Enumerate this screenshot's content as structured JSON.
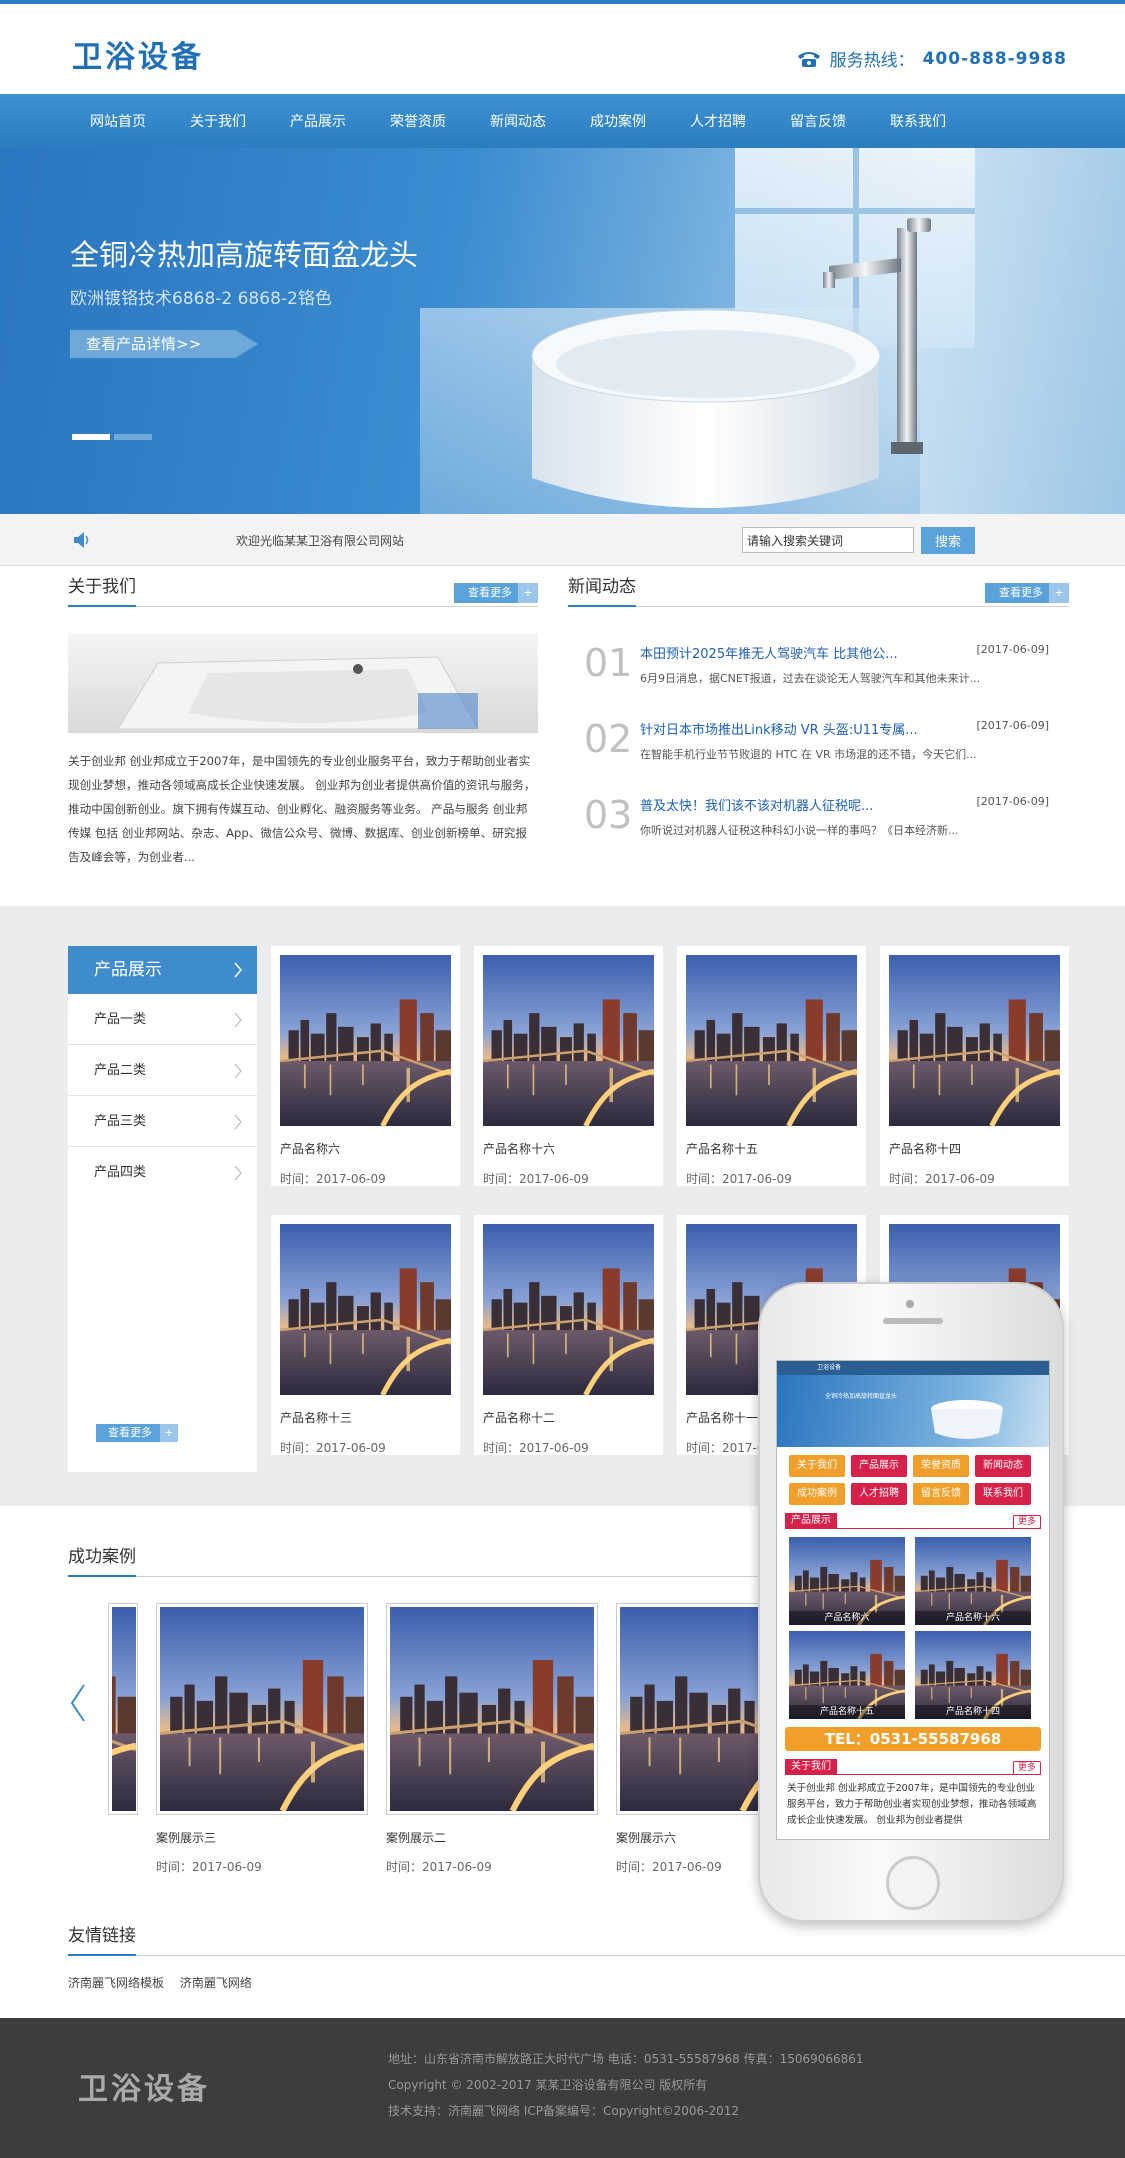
{
  "header": {
    "logo": "卫浴设备",
    "hotline_label": "服务热线：",
    "hotline_number": "400-888-9988"
  },
  "nav": [
    "网站首页",
    "关于我们",
    "产品展示",
    "荣誉资质",
    "新闻动态",
    "成功案例",
    "人才招聘",
    "留言反馈",
    "联系我们"
  ],
  "banner": {
    "title": "全铜冷热加高旋转面盆龙头",
    "subtitle": "欧洲镀铬技术6868-2 6868-2铬色",
    "button": "查看产品详情>>",
    "slides": 2,
    "active_slide": 1
  },
  "notice": {
    "welcome": "欢迎光临某某卫浴有限公司网站",
    "search_value": "请输入搜索关键词",
    "search_button": "搜索"
  },
  "about": {
    "title": "关于我们",
    "more": "查看更多",
    "text": "关于创业邦 创业邦成立于2007年，是中国领先的专业创业服务平台，致力于帮助创业者实现创业梦想，推动各领域高成长企业快速发展。 创业邦为创业者提供高价值的资讯与服务，推动中国创新创业。旗下拥有传媒互动、创业孵化、融资服务等业务。 产品与服务 创业邦传媒 包括 创业邦网站、杂志、App、微信公众号、微博、数据库、创业创新榜单、研究报告及峰会等，为创业者..."
  },
  "news": {
    "title": "新闻动态",
    "more": "查看更多",
    "items": [
      {
        "num": "01",
        "title": "本田预计2025年推无人驾驶汽车 比其他公...",
        "date": "[2017-06-09]",
        "summary": "6月9日消息，据CNET报道，过去在谈论无人驾驶汽车和其他未来计..."
      },
      {
        "num": "02",
        "title": "针对日本市场推出Link移动 VR 头盔:U11专属...",
        "date": "[2017-06-09]",
        "summary": "在智能手机行业节节败退的 HTC 在 VR 市场混的还不错，今天它们..."
      },
      {
        "num": "03",
        "title": "普及太快！我们该不该对机器人征税呢...",
        "date": "[2017-06-09]",
        "summary": "你听说过对机器人征税这种科幻小说一样的事吗？《日本经济新..."
      }
    ]
  },
  "products": {
    "side_title": "产品展示",
    "categories": [
      "产品一类",
      "产品二类",
      "产品三类",
      "产品四类"
    ],
    "more": "查看更多",
    "items": [
      {
        "name": "产品名称六",
        "date": "时间：2017-06-09"
      },
      {
        "name": "产品名称十六",
        "date": "时间：2017-06-09"
      },
      {
        "name": "产品名称十五",
        "date": "时间：2017-06-09"
      },
      {
        "name": "产品名称十四",
        "date": "时间：2017-06-09"
      },
      {
        "name": "产品名称十三",
        "date": "时间：2017-06-09"
      },
      {
        "name": "产品名称十二",
        "date": "时间：2017-06-09"
      },
      {
        "name": "产品名称十一",
        "date": "时间：2017-06-09"
      },
      {
        "name": "",
        "date": ""
      }
    ]
  },
  "cases": {
    "title": "成功案例",
    "items": [
      {
        "name": "案例展示三",
        "date": "时间：2017-06-09"
      },
      {
        "name": "案例展示二",
        "date": "时间：2017-06-09"
      },
      {
        "name": "案例展示六",
        "date": "时间：2017-06-09"
      }
    ]
  },
  "links": {
    "title": "友情链接",
    "items": [
      "济南麗飞网络模板",
      "济南麗飞网络"
    ]
  },
  "footer": {
    "logo": "卫浴设备",
    "lines": [
      "地址：山东省济南市解放路正大时代广场   电话：0531-55587968   传真：15069066861",
      "Copyright © 2002-2017 某某卫浴设备有限公司 版权所有",
      "技术支持：济南麗飞网络 ICP备案编号：Copyright©2006-2012"
    ]
  },
  "mobile": {
    "header": "卫浴设备",
    "banner_text": "全铜冷热加高旋转面盆龙头",
    "menu": [
      "关于我们",
      "产品展示",
      "荣誉资质",
      "新闻动态",
      "成功案例",
      "人才招聘",
      "留言反馈",
      "联系我们"
    ],
    "product_bar": "产品展示",
    "more": "更多",
    "products": [
      "产品名称六",
      "产品名称十六",
      "产品名称十五",
      "产品名称十四"
    ],
    "tel": "TEL：0531-55587968",
    "about_bar": "关于我们",
    "about_text": "关于创业邦 创业邦成立于2007年，是中国领先的专业创业服务平台，致力于帮助创业者实现创业梦想，推动各领域高成长企业快速发展。 创业邦为创业者提供"
  },
  "colors": {
    "primary": "#2b7dc0",
    "accent_orange": "#f0a02a",
    "accent_red": "#d6214a",
    "footer_bg": "#3d3d3d"
  }
}
